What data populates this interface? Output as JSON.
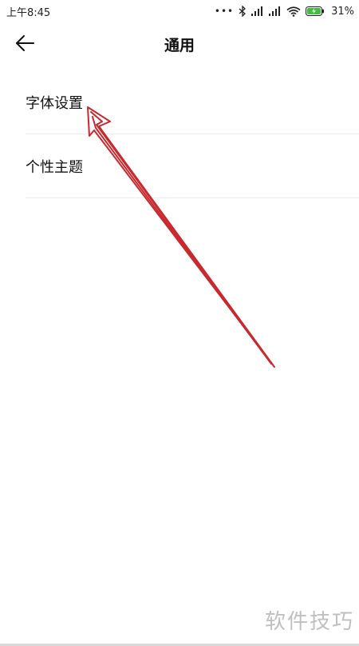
{
  "status_bar": {
    "time": "上午8:45",
    "dots": "•••",
    "battery_percent": "31%"
  },
  "header": {
    "title": "通用",
    "back_icon": "arrow-left-icon"
  },
  "settings": {
    "items": [
      {
        "label": "字体设置"
      },
      {
        "label": "个性主题"
      }
    ]
  },
  "annotation": {
    "type": "arrow",
    "color": "#c8282e",
    "points_to": "字体设置"
  },
  "watermark": {
    "text": "软件技巧"
  },
  "colors": {
    "background": "#ffffff",
    "text": "#111111",
    "divider": "#ececec",
    "battery_green": "#3fbf3f"
  }
}
